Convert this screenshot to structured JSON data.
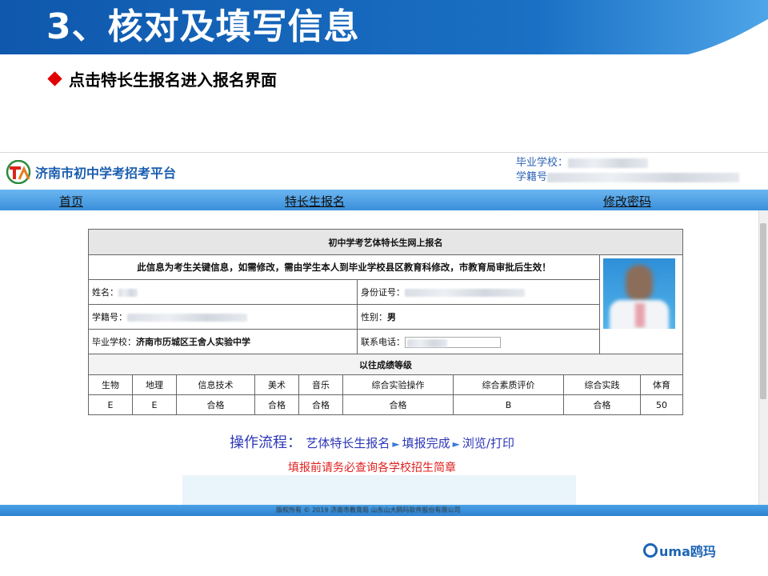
{
  "slide": {
    "title": "3、核对及填写信息",
    "bullet": "点击特长生报名进入报名界面"
  },
  "site": {
    "name": "济南市初中学考招考平台",
    "user_school_label": "毕业学校：",
    "user_id_label": "学籍号"
  },
  "nav": {
    "home": "首页",
    "signup": "特长生报名",
    "password": "修改密码"
  },
  "form": {
    "title": "初中学考艺体特长生网上报名",
    "notice": "此信息为考生关键信息，如需修改，需由学生本人到毕业学校县区教育科修改，市教育局审批后生效！",
    "name_label": "姓名：",
    "idcard_label": "身份证号：",
    "studentid_label": "学籍号：",
    "gender_label": "性别：",
    "gender_value": "男",
    "school_label": "毕业学校：",
    "school_value": "济南市历城区王舍人实验中学",
    "phone_label": "联系电话："
  },
  "grades": {
    "title": "以往成绩等级",
    "headers": [
      "生物",
      "地理",
      "信息技术",
      "美术",
      "音乐",
      "综合实验操作",
      "综合素质评价",
      "综合实践",
      "体育"
    ],
    "values": [
      "E",
      "E",
      "合格",
      "合格",
      "合格",
      "合格",
      "B",
      "合格",
      "50"
    ]
  },
  "flow": {
    "label": "操作流程：",
    "step1": "艺体特长生报名",
    "step2": "填报完成",
    "step3": "浏览/打印"
  },
  "warning": "填报前请务必查询各学校招生简章",
  "footer": "版权所有 © 2019 济南市教育局 山东山大鸥玛软件股份有限公司",
  "brand": {
    "name": "uma鸥玛"
  },
  "colors": {
    "header_blue": "#1565b8",
    "link_blue": "#2d37b8",
    "warning_red": "#e02020",
    "bullet_red": "#e00000"
  }
}
